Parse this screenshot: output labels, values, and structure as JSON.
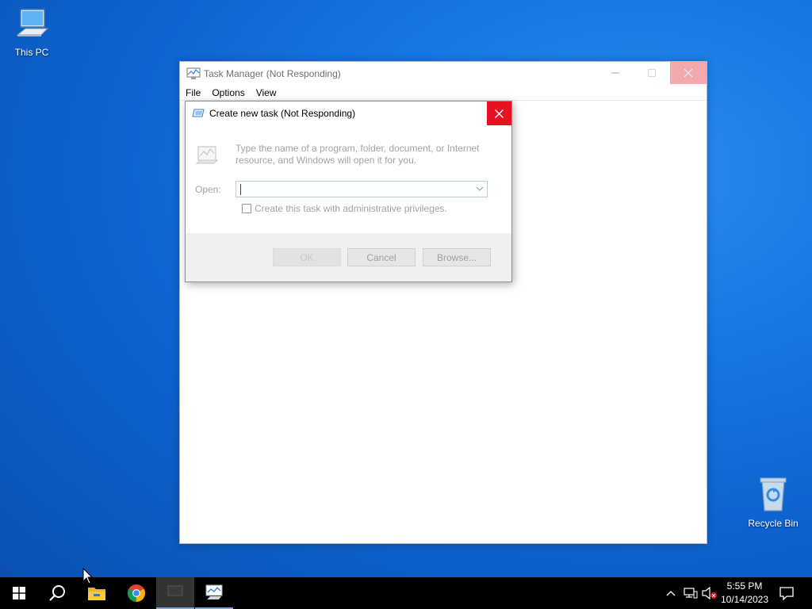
{
  "desktop": {
    "icons": [
      {
        "label": "This PC",
        "icon": "this-pc-icon"
      },
      {
        "label": "Recycle Bin",
        "icon": "recycle-bin-icon"
      }
    ]
  },
  "task_manager": {
    "title": "Task Manager (Not Responding)",
    "menu": [
      "File",
      "Options",
      "View"
    ]
  },
  "dialog": {
    "title": "Create new task (Not Responding)",
    "description": "Type the name of a program, folder, document, or Internet resource, and Windows will open it for you.",
    "open_label": "Open:",
    "open_value": "",
    "admin_checkbox_label": "Create this task with administrative privileges.",
    "admin_checked": false,
    "buttons": {
      "ok": "OK",
      "cancel": "Cancel",
      "browse": "Browse..."
    }
  },
  "taskbar": {
    "items": [
      "start-icon",
      "search-icon",
      "file-explorer-icon",
      "chrome-icon",
      "task-manager-icon",
      "task-manager-icon"
    ],
    "clock": {
      "time": "5:55 PM",
      "date": "10/14/2023"
    }
  },
  "colors": {
    "dialog_close": "#e81123",
    "taskbar": "#000000",
    "desktop": "#1677e3"
  }
}
